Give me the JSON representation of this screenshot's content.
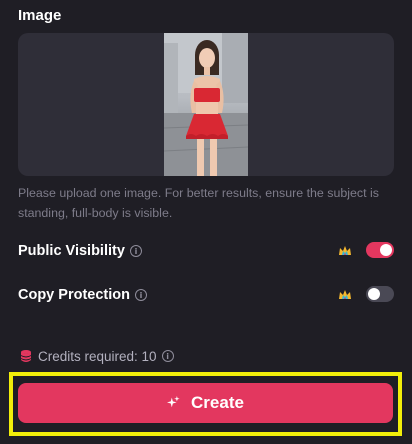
{
  "image_section": {
    "title": "Image",
    "hint": "Please upload one image. For better results, ensure the subject is standing, full-body is visible."
  },
  "settings": {
    "public_visibility": {
      "label": "Public Visibility",
      "enabled": true
    },
    "copy_protection": {
      "label": "Copy Protection",
      "enabled": false
    }
  },
  "credits": {
    "text": "Credits required: 10"
  },
  "create_button": {
    "label": "Create"
  },
  "icons": {
    "info": "info-icon",
    "premium": "crown-icon",
    "credits": "database-icon",
    "create": "sparkle-icon"
  },
  "colors": {
    "background": "#1f1e25",
    "panel": "#2f2e38",
    "accent": "#e3375f",
    "highlight": "#f2ee0a",
    "muted_text": "#7e7c8a"
  }
}
